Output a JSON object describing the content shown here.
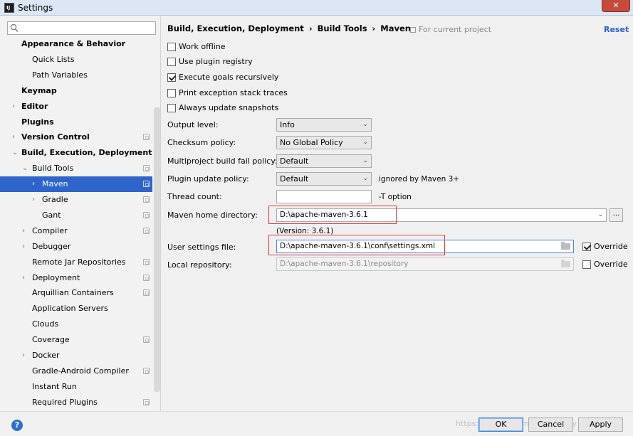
{
  "window": {
    "title": "Settings",
    "app_icon_text": "IJ",
    "close_label": "✕"
  },
  "search": {
    "placeholder": ""
  },
  "sidebar": {
    "items": [
      {
        "label": "Appearance & Behavior",
        "bold": true,
        "arrow": "",
        "indent": 0,
        "proj": false
      },
      {
        "label": "Quick Lists",
        "bold": false,
        "arrow": "",
        "indent": 1,
        "proj": false
      },
      {
        "label": "Path Variables",
        "bold": false,
        "arrow": "",
        "indent": 1,
        "proj": false
      },
      {
        "label": "Keymap",
        "bold": true,
        "arrow": "",
        "indent": 0,
        "proj": false
      },
      {
        "label": "Editor",
        "bold": true,
        "arrow": "›",
        "indent": 0,
        "proj": false
      },
      {
        "label": "Plugins",
        "bold": true,
        "arrow": "",
        "indent": 0,
        "proj": false
      },
      {
        "label": "Version Control",
        "bold": true,
        "arrow": "›",
        "indent": 0,
        "proj": true
      },
      {
        "label": "Build, Execution, Deployment",
        "bold": true,
        "arrow": "⌄",
        "indent": 0,
        "proj": false
      },
      {
        "label": "Build Tools",
        "bold": false,
        "arrow": "⌄",
        "indent": 1,
        "proj": true
      },
      {
        "label": "Maven",
        "bold": false,
        "arrow": "›",
        "indent": 2,
        "proj": true,
        "selected": true
      },
      {
        "label": "Gradle",
        "bold": false,
        "arrow": "›",
        "indent": 2,
        "proj": true
      },
      {
        "label": "Gant",
        "bold": false,
        "arrow": "",
        "indent": 2,
        "proj": true
      },
      {
        "label": "Compiler",
        "bold": false,
        "arrow": "›",
        "indent": 1,
        "proj": true
      },
      {
        "label": "Debugger",
        "bold": false,
        "arrow": "›",
        "indent": 1,
        "proj": false
      },
      {
        "label": "Remote Jar Repositories",
        "bold": false,
        "arrow": "",
        "indent": 1,
        "proj": true
      },
      {
        "label": "Deployment",
        "bold": false,
        "arrow": "›",
        "indent": 1,
        "proj": true
      },
      {
        "label": "Arquillian Containers",
        "bold": false,
        "arrow": "",
        "indent": 1,
        "proj": true
      },
      {
        "label": "Application Servers",
        "bold": false,
        "arrow": "",
        "indent": 1,
        "proj": false
      },
      {
        "label": "Clouds",
        "bold": false,
        "arrow": "",
        "indent": 1,
        "proj": false
      },
      {
        "label": "Coverage",
        "bold": false,
        "arrow": "",
        "indent": 1,
        "proj": true
      },
      {
        "label": "Docker",
        "bold": false,
        "arrow": "›",
        "indent": 1,
        "proj": false
      },
      {
        "label": "Gradle-Android Compiler",
        "bold": false,
        "arrow": "",
        "indent": 1,
        "proj": true
      },
      {
        "label": "Instant Run",
        "bold": false,
        "arrow": "",
        "indent": 1,
        "proj": false
      },
      {
        "label": "Required Plugins",
        "bold": false,
        "arrow": "",
        "indent": 1,
        "proj": true
      }
    ]
  },
  "breadcrumb": {
    "part1": "Build, Execution, Deployment",
    "sep": "›",
    "part2": "Build Tools",
    "part3": "Maven"
  },
  "for_project": "For current project",
  "reset_label": "Reset",
  "checkboxes": {
    "work_offline": {
      "label": "Work offline",
      "checked": false
    },
    "plugin_registry": {
      "label": "Use plugin registry",
      "checked": false
    },
    "execute_goals": {
      "label": "Execute goals recursively",
      "checked": true
    },
    "print_exception": {
      "label": "Print exception stack traces",
      "checked": false
    },
    "always_update": {
      "label": "Always update snapshots",
      "checked": false
    }
  },
  "form": {
    "output_level": {
      "label": "Output level:",
      "value": "Info"
    },
    "checksum_policy": {
      "label": "Checksum policy:",
      "value": "No Global Policy"
    },
    "multiproject": {
      "label": "Multiproject build fail policy:",
      "value": "Default"
    },
    "plugin_update": {
      "label": "Plugin update policy:",
      "value": "Default",
      "hint": "ignored by Maven 3+"
    },
    "thread_count": {
      "label": "Thread count:",
      "value": "",
      "hint": "-T option"
    },
    "maven_home": {
      "label": "Maven home directory:",
      "value": "D:\\apache-maven-3.6.1",
      "browse": "...",
      "version": "(Version: 3.6.1)"
    },
    "user_settings": {
      "label": "User settings file:",
      "value": "D:\\apache-maven-3.6.1\\conf\\settings.xml",
      "override_label": "Override",
      "override_checked": true
    },
    "local_repo": {
      "label": "Local repository:",
      "value": "D:\\apache-maven-3.6.1\\repository",
      "override_label": "Override",
      "override_checked": false
    }
  },
  "footer": {
    "help": "?",
    "ok": "OK",
    "cancel": "Cancel",
    "apply": "Apply",
    "watermark": "https://blog.csdn.net/hellozhxy"
  },
  "colors": {
    "selection": "#2f65ca",
    "accent": "#2b62c8",
    "highlight_box": "#e23a3a"
  }
}
